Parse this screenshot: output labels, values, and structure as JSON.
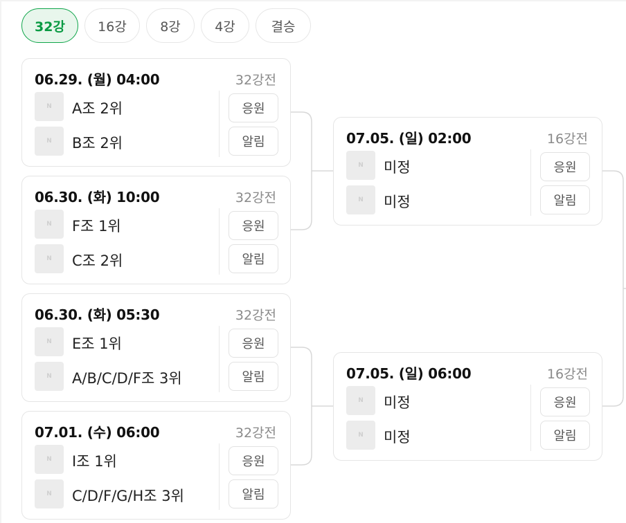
{
  "tabs": [
    {
      "label": "32강",
      "active": true
    },
    {
      "label": "16강",
      "active": false
    },
    {
      "label": "8강",
      "active": false
    },
    {
      "label": "4강",
      "active": false
    },
    {
      "label": "결승",
      "active": false
    }
  ],
  "logo_text": "N",
  "buttons": {
    "cheer": "응원",
    "alarm": "알림"
  },
  "matches": [
    {
      "date": "06.29. (월) 04:00",
      "round": "32강전",
      "team1": "A조 2위",
      "team2": "B조 2위"
    },
    {
      "date": "06.30. (화) 10:00",
      "round": "32강전",
      "team1": "F조 1위",
      "team2": "C조 2위"
    },
    {
      "date": "06.30. (화) 05:30",
      "round": "32강전",
      "team1": "E조 1위",
      "team2": "A/B/C/D/F조 3위"
    },
    {
      "date": "07.01. (수) 06:00",
      "round": "32강전",
      "team1": "I조 1위",
      "team2": "C/D/F/G/H조 3위"
    },
    {
      "date": "07.05. (일) 02:00",
      "round": "16강전",
      "team1": "미정",
      "team2": "미정"
    },
    {
      "date": "07.05. (일) 06:00",
      "round": "16강전",
      "team1": "미정",
      "team2": "미정"
    }
  ],
  "colors": {
    "accent": "#0a9a43",
    "accent_bg": "#e8f6ec",
    "border": "#e5e5e5",
    "muted": "#8a8a8a"
  }
}
